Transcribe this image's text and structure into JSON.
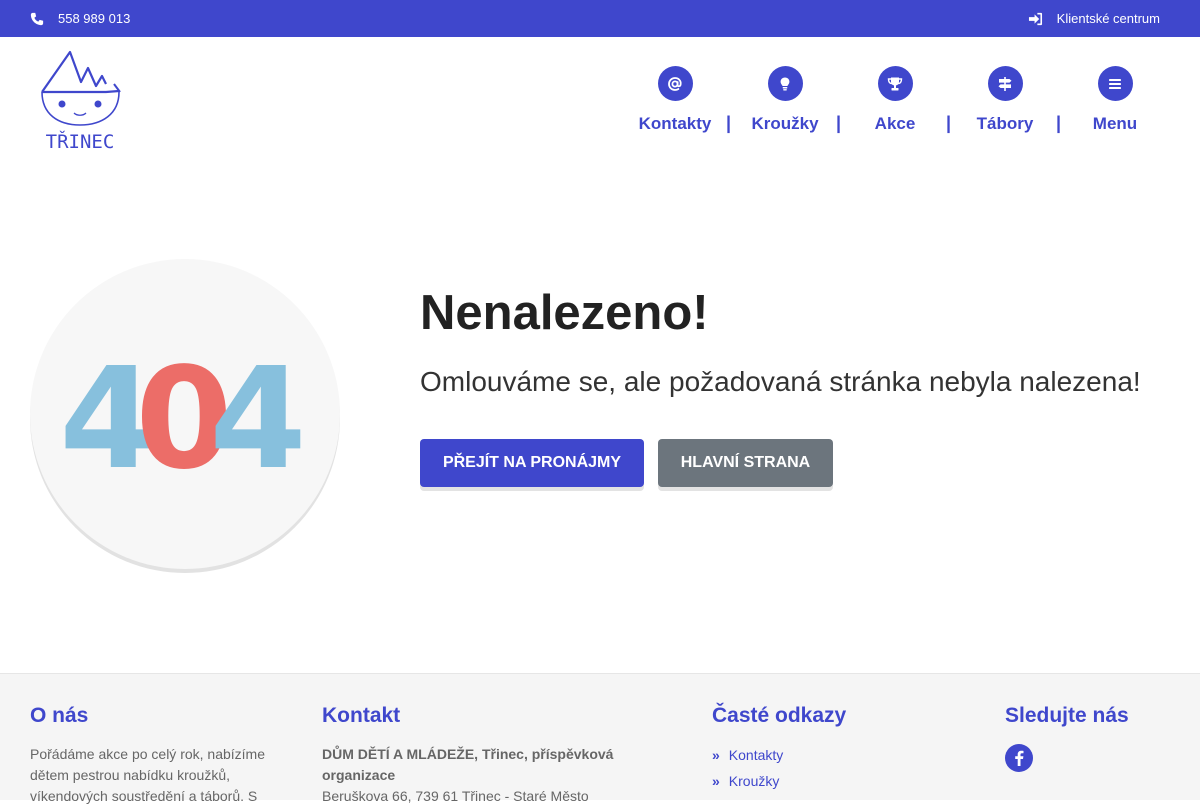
{
  "topbar": {
    "phone": "558 989 013",
    "client_center": "Klientské centrum"
  },
  "logo": {
    "text": "TŘINEC"
  },
  "nav": [
    {
      "label": "Kontakty",
      "icon": "at-icon"
    },
    {
      "label": "Kroužky",
      "icon": "lightbulb-icon"
    },
    {
      "label": "Akce",
      "icon": "trophy-icon"
    },
    {
      "label": "Tábory",
      "icon": "signpost-icon"
    },
    {
      "label": "Menu",
      "icon": "menu-icon"
    }
  ],
  "nav_separator": "|",
  "error": {
    "code_digits": [
      "4",
      "0",
      "4"
    ],
    "digit_colors": [
      "#87c0dd",
      "#ec6d68",
      "#87c0dd"
    ],
    "title": "Nenalezeno!",
    "message": "Omlouváme se, ale požadovaná stránka nebyla nalezena!",
    "primary_button": "PŘEJÍT NA PRONÁJMY",
    "secondary_button": "HLAVNÍ STRANA"
  },
  "footer": {
    "about": {
      "title": "O nás",
      "text": "Pořádáme akce po celý rok, nabízíme dětem pestrou nabídku kroužků, víkendových soustředění a táborů. S"
    },
    "contact": {
      "title": "Kontakt",
      "org": "DŮM DĚTÍ A MLÁDEŽE, Třinec, příspěvková organizace",
      "address": "Beruškova 66, 739 61 Třinec - Staré Město"
    },
    "links": {
      "title": "Časté odkazy",
      "items": [
        "Kontakty",
        "Kroužky"
      ]
    },
    "social": {
      "title": "Sledujte nás",
      "icon": "facebook-icon"
    }
  },
  "colors": {
    "brand": "#3f47cc",
    "secondary": "#6c757d",
    "footer_bg": "#f5f5f5"
  }
}
